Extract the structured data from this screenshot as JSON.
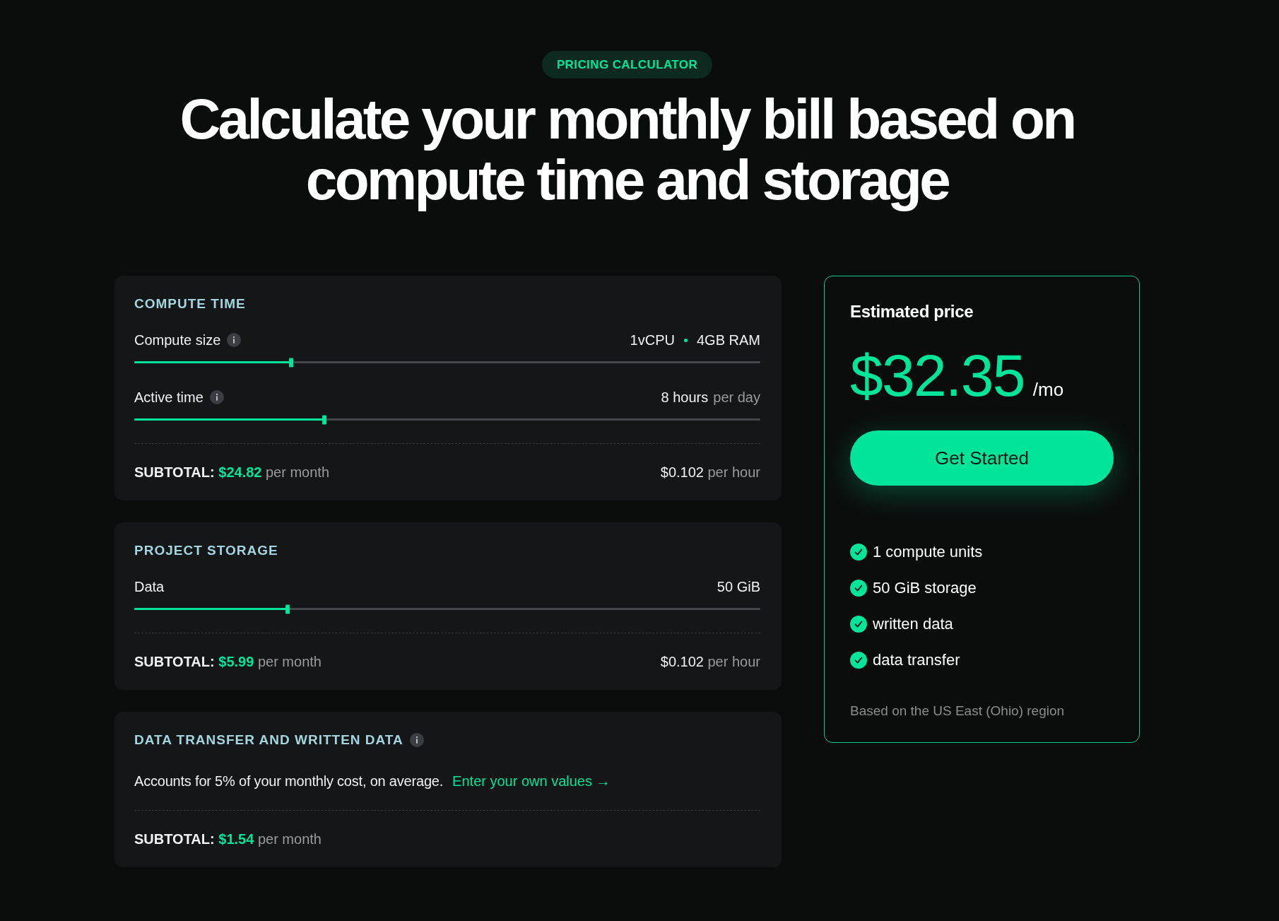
{
  "badge": "PRICING CALCULATOR",
  "heading_lines": [
    "Calculate your monthly bill based on",
    "compute time and storage"
  ],
  "sections": [
    {
      "kind": "sliders",
      "title": "COMPUTE TIME",
      "info": false,
      "sliders": [
        {
          "label": "Compute size",
          "info": true,
          "value_parts": [
            "1vCPU",
            "4GB RAM"
          ],
          "level": 0.25
        },
        {
          "label": "Active time",
          "info": true,
          "value_parts": [
            "8 hours"
          ],
          "unit": "per day",
          "level": 0.304
        }
      ],
      "subtotal": {
        "label": "SUBTOTAL:",
        "amount": "$24.82",
        "period": "per month"
      },
      "rate": {
        "amount": "$0.102",
        "unit": "per hour"
      }
    },
    {
      "kind": "sliders",
      "title": "PROJECT STORAGE",
      "info": false,
      "sliders": [
        {
          "label": "Data",
          "info": false,
          "value_parts": [
            "50 GiB"
          ],
          "level": 0.245
        }
      ],
      "subtotal": {
        "label": "SUBTOTAL:",
        "amount": "$5.99",
        "period": "per month"
      },
      "rate": {
        "amount": "$0.102",
        "unit": "per hour"
      }
    },
    {
      "kind": "note",
      "title": "DATA TRANSFER AND WRITTEN DATA",
      "info": true,
      "note": "Accounts for 5% of your monthly cost, on average.",
      "link": "Enter your own values →",
      "subtotal": {
        "label": "SUBTOTAL:",
        "amount": "$1.54",
        "period": "per month"
      }
    }
  ],
  "estimate": {
    "title": "Estimated price",
    "price": "$32.35",
    "period": "/mo",
    "button": "Get Started",
    "features": [
      "1 compute units",
      "50 GiB storage",
      "written data",
      "data transfer"
    ],
    "footnote": "Based on the US East (Ohio) region"
  }
}
